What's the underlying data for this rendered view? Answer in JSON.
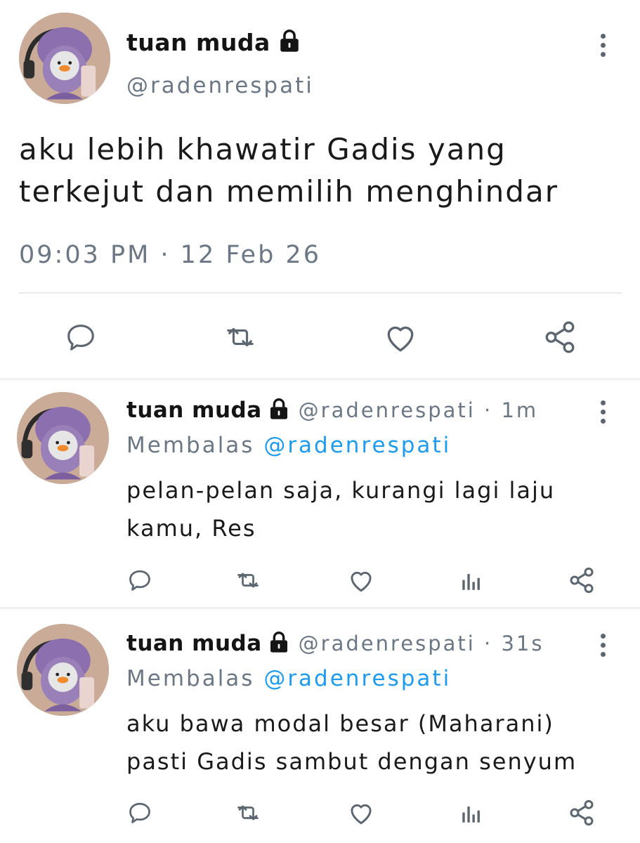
{
  "main_tweet": {
    "display_name": "tuan muda",
    "handle": "@radenrespati",
    "text_line1": "aku lebih khawatir Gadis yang",
    "text_line2": "terkejut dan memilih menghindar",
    "timestamp": "09:03 PM · 12 Feb 26"
  },
  "replies": [
    {
      "display_name": "tuan muda",
      "handle_time": "@radenrespati · 1m",
      "replying_prefix": "Membalas",
      "replying_to": "@radenrespati",
      "text_line1": "pelan-pelan saja, kurangi lagi laju",
      "text_line2": "kamu, Res"
    },
    {
      "display_name": "tuan muda",
      "handle_time": "@radenrespati · 31s",
      "replying_prefix": "Membalas",
      "replying_to": "@radenrespati",
      "text_line1": "aku bawa modal besar (Maharani)",
      "text_line2": "pasti Gadis sambut dengan senyum"
    }
  ],
  "icons": {
    "reply": "reply-icon",
    "retweet": "retweet-icon",
    "like": "heart-icon",
    "views": "views-icon",
    "share": "share-icon",
    "lock": "lock-icon",
    "more": "more-icon"
  },
  "colors": {
    "link": "#1d9bf0",
    "muted": "#6b7784",
    "icon": "#5b6670",
    "divider": "#eef0f2"
  }
}
